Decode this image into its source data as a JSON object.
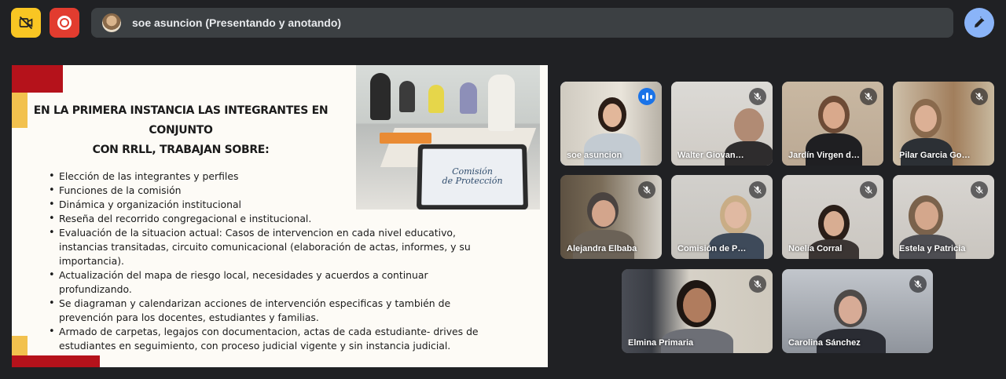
{
  "colors": {
    "background": "#202124",
    "camera_off_button": "#f9c623",
    "record_button": "#e23c2f",
    "annotate_button": "#8ab4f8",
    "active_speaker_border": "#8ab4f8"
  },
  "top_bar": {
    "camera_off_icon": "video-off-icon",
    "record_icon": "record-icon",
    "presenter_label": "soe asuncion (Presentando y anotando)",
    "annotate_icon": "pen-icon"
  },
  "slide": {
    "title_line1": "EN LA PRIMERA INSTANCIA LAS INTEGRANTES EN CONJUNTO",
    "title_line2": "CON RRLL, TRABAJAN SOBRE:",
    "laptop_text_line1": "Comisión",
    "laptop_text_line2": "de Protección",
    "bullets": [
      "Elección de las integrantes y perfiles",
      "Funciones de la comisión",
      "Dinámica y organización institucional",
      "Reseña del recorrido congregacional e institucional.",
      "Evaluación de la situacion actual: Casos de intervencion en cada nivel educativo, instancias transitadas, circuito comunicacional (elaboración de actas, informes, y su importancia).",
      "Actualización del mapa de riesgo local, necesidades y acuerdos a continuar profundizando.",
      "Se diagraman y calendarizan acciones de intervención especificas y también de prevención para los docentes, estudiantes y familias.",
      "Armado de carpetas, legajos con documentacion, actas de cada estudiante- drives de estudiantes en seguimiento, con proceso judicial vigente y sin instancia judicial."
    ]
  },
  "participants": [
    {
      "name": "soe asuncion",
      "status_icon": "speaking-indicator-icon"
    },
    {
      "name": "Walter Giovannini",
      "status_icon": "mic-off-icon"
    },
    {
      "name": "Jardín Virgen del ...",
      "status_icon": "mic-off-icon"
    },
    {
      "name": "Pilar Garcia Gonz...",
      "status_icon": "mic-off-icon"
    },
    {
      "name": "Alejandra Elbaba",
      "status_icon": "mic-off-icon"
    },
    {
      "name": "Comisión de Prot...",
      "status_icon": "mic-off-icon"
    },
    {
      "name": "Noelia Corral",
      "status_icon": "mic-off-icon"
    },
    {
      "name": "Estela y Patricia",
      "status_icon": "mic-off-icon"
    },
    {
      "name": "Elmina Primaria",
      "status_icon": "mic-off-icon"
    },
    {
      "name": "Carolina Sánchez",
      "status_icon": "mic-off-icon"
    }
  ]
}
